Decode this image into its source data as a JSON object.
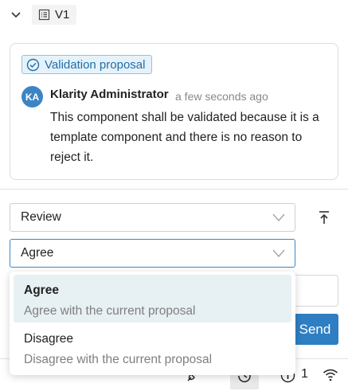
{
  "version": {
    "label": "V1"
  },
  "comment_card": {
    "badge_label": "Validation proposal",
    "avatar_initials": "KA",
    "author": "Klarity Administrator",
    "timestamp": "a few seconds ago",
    "text": "This component shall be validated because it is a template component and there is no reason to reject it."
  },
  "form": {
    "type_select_value": "Review",
    "vote_select_value": "Agree",
    "send_label": "Send"
  },
  "vote_options": [
    {
      "title": "Agree",
      "description": "Agree with the current proposal"
    },
    {
      "title": "Disagree",
      "description": "Disagree with the current proposal"
    }
  ],
  "status_bar": {
    "info_count": "1"
  },
  "colors": {
    "accent": "#2e7ec4",
    "badge_bg": "#e6f2fa",
    "selected_option_bg": "#e7f0f3"
  }
}
